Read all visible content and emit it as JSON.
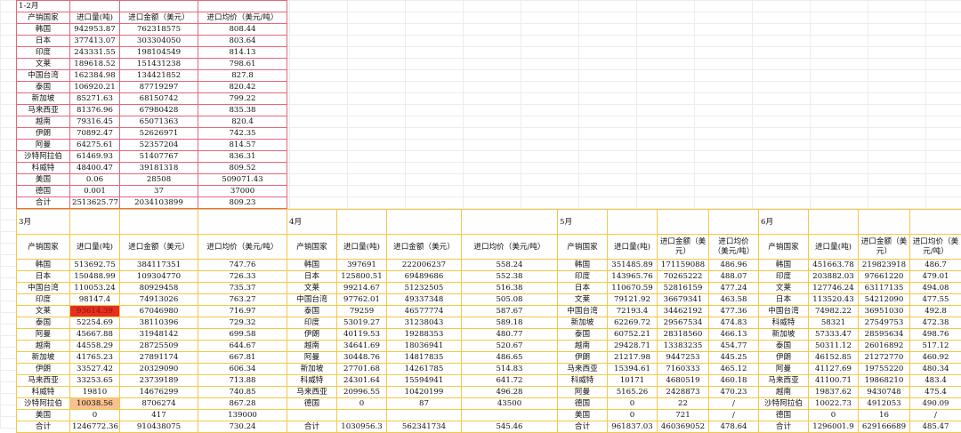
{
  "top": {
    "title": "1-2月",
    "headers": [
      "产销国家",
      "进口量(吨)",
      "进口金额（美元）",
      "进口均价（美元/吨）"
    ],
    "rows": [
      [
        "韩国",
        "942953.87",
        "762318575",
        "808.44"
      ],
      [
        "日本",
        "377413.07",
        "303304050",
        "803.64"
      ],
      [
        "印度",
        "243331.55",
        "198104549",
        "814.13"
      ],
      [
        "文莱",
        "189618.52",
        "151431238",
        "798.61"
      ],
      [
        "中国台湾",
        "162384.98",
        "134421852",
        "827.8"
      ],
      [
        "泰国",
        "106920.21",
        "87719297",
        "820.42"
      ],
      [
        "新加坡",
        "85271.63",
        "68150742",
        "799.22"
      ],
      [
        "马来西亚",
        "81376.96",
        "67980428",
        "835.38"
      ],
      [
        "越南",
        "79316.45",
        "65071363",
        "820.4"
      ],
      [
        "伊朗",
        "70892.47",
        "52626971",
        "742.35"
      ],
      [
        "阿曼",
        "64275.61",
        "52357204",
        "814.57"
      ],
      [
        "沙特阿拉伯",
        "61469.93",
        "51407767",
        "836.31"
      ],
      [
        "科威特",
        "48400.47",
        "39181318",
        "809.52"
      ],
      [
        "美国",
        "0.06",
        "28508",
        "509071.43"
      ],
      [
        "德国",
        "0.001",
        "37",
        "37000"
      ],
      [
        "合计",
        "2513625.77",
        "2034103899",
        "809.23"
      ]
    ]
  },
  "m3": {
    "month": "3月",
    "headers": [
      "产销国家",
      "进口量(吨)",
      "进口金额（美元）",
      "进口均价（美元/吨）"
    ],
    "rows": [
      [
        "韩国",
        "513692.75",
        "384117351",
        "747.76"
      ],
      [
        "日本",
        "150488.99",
        "109304770",
        "726.33"
      ],
      [
        "中国台湾",
        "110053.24",
        "80929458",
        "735.37"
      ],
      [
        "印度",
        "98147.4",
        "74913026",
        "763.27"
      ],
      [
        "文莱",
        "93614.39",
        "67046980",
        "716.97"
      ],
      [
        "泰国",
        "52254.69",
        "38110396",
        "729.32"
      ],
      [
        "阿曼",
        "45667.88",
        "31948142",
        "699.58"
      ],
      [
        "越南",
        "44558.29",
        "28725509",
        "644.67"
      ],
      [
        "新加坡",
        "41765.23",
        "27891174",
        "667.81"
      ],
      [
        "伊朗",
        "33527.42",
        "20329090",
        "606.34"
      ],
      [
        "马来西亚",
        "33253.65",
        "23739189",
        "713.88"
      ],
      [
        "科威特",
        "19810",
        "14676299",
        "740.85"
      ],
      [
        "沙特阿拉伯",
        "10038.56",
        "8706274",
        "867.28"
      ],
      [
        "美国",
        "0",
        "417",
        "139000"
      ],
      [
        "合计",
        "1246772.36",
        "910438075",
        "730.24"
      ]
    ]
  },
  "m4": {
    "month": "4月",
    "headers": [
      "产销国家",
      "进口量(吨)",
      "进口金额（美元）",
      "进口均价（美元/吨）"
    ],
    "rows": [
      [
        "韩国",
        "397691",
        "222006237",
        "558.24"
      ],
      [
        "日本",
        "125800.51",
        "69489686",
        "552.38"
      ],
      [
        "文莱",
        "99214.67",
        "51232505",
        "516.38"
      ],
      [
        "中国台湾",
        "97762.01",
        "49337348",
        "505.08"
      ],
      [
        "泰国",
        "79259",
        "46577774",
        "587.67"
      ],
      [
        "印度",
        "53019.27",
        "31238043",
        "589.18"
      ],
      [
        "伊朗",
        "40119.53",
        "19288353",
        "480.77"
      ],
      [
        "越南",
        "34641.69",
        "18036941",
        "520.67"
      ],
      [
        "阿曼",
        "30448.76",
        "14817835",
        "486.65"
      ],
      [
        "新加坡",
        "27701.68",
        "14261785",
        "514.83"
      ],
      [
        "科威特",
        "24301.64",
        "15594941",
        "641.72"
      ],
      [
        "马来西亚",
        "20996.55",
        "10420199",
        "496.28"
      ],
      [
        "德国",
        "0",
        "87",
        "43500"
      ],
      [
        "",
        "",
        "",
        ""
      ],
      [
        "合计",
        "1030956.3",
        "562341734",
        "545.46"
      ]
    ]
  },
  "m5": {
    "month": "5月",
    "headers": [
      "产销国家",
      "进口量(吨)",
      "进口金额（美元）",
      "进口均价（美元/吨）"
    ],
    "rows": [
      [
        "韩国",
        "351485.89",
        "171159088",
        "486.96"
      ],
      [
        "印度",
        "143965.76",
        "70265222",
        "488.07"
      ],
      [
        "日本",
        "110670.59",
        "52816159",
        "477.24"
      ],
      [
        "文莱",
        "79121.92",
        "36679341",
        "463.58"
      ],
      [
        "中国台湾",
        "72193.4",
        "34462192",
        "477.36"
      ],
      [
        "新加坡",
        "62269.72",
        "29567534",
        "474.83"
      ],
      [
        "泰国",
        "60752.21",
        "28318560",
        "466.13"
      ],
      [
        "越南",
        "29428.71",
        "13383235",
        "454.77"
      ],
      [
        "伊朗",
        "21217.98",
        "9447253",
        "445.25"
      ],
      [
        "马来西亚",
        "15394.61",
        "7160333",
        "465.12"
      ],
      [
        "科威特",
        "10171",
        "4680519",
        "460.18"
      ],
      [
        "阿曼",
        "5165.26",
        "2428873",
        "470.23"
      ],
      [
        "德国",
        "0",
        "22",
        "/"
      ],
      [
        "美国",
        "0",
        "721",
        "/"
      ],
      [
        "合计",
        "961837.03",
        "460369052",
        "478.64"
      ]
    ]
  },
  "m6": {
    "month": "6月",
    "headers": [
      "产销国家",
      "进口量(吨)",
      "进口金额（美元）",
      "进口均价（美元/吨）"
    ],
    "rows": [
      [
        "韩国",
        "451663.78",
        "219823918",
        "486.7"
      ],
      [
        "印度",
        "203882.03",
        "97661220",
        "479.01"
      ],
      [
        "文莱",
        "127746.24",
        "63117135",
        "494.08"
      ],
      [
        "日本",
        "113520.43",
        "54212090",
        "477.55"
      ],
      [
        "中国台湾",
        "74982.22",
        "36951030",
        "492.8"
      ],
      [
        "科威特",
        "58321",
        "27549753",
        "472.38"
      ],
      [
        "新加坡",
        "57333.47",
        "28595634",
        "498.76"
      ],
      [
        "泰国",
        "50311.12",
        "26016892",
        "517.12"
      ],
      [
        "伊朗",
        "46152.85",
        "21272770",
        "460.92"
      ],
      [
        "阿曼",
        "41127.69",
        "19755220",
        "480.34"
      ],
      [
        "马来西亚",
        "41100.71",
        "19868210",
        "483.4"
      ],
      [
        "越南",
        "19837.62",
        "9430748",
        "475.4"
      ],
      [
        "沙特阿拉伯",
        "10022.73",
        "4912053",
        "490.09"
      ],
      [
        "德国",
        "0",
        "16",
        "/"
      ],
      [
        "合计",
        "1296001.9",
        "629166689",
        "485.47"
      ]
    ]
  },
  "highlights": {
    "red": "#e8301f",
    "peach": "#fac08f",
    "top_border": "#e0697a",
    "yellow_border": "#f0c94a"
  }
}
